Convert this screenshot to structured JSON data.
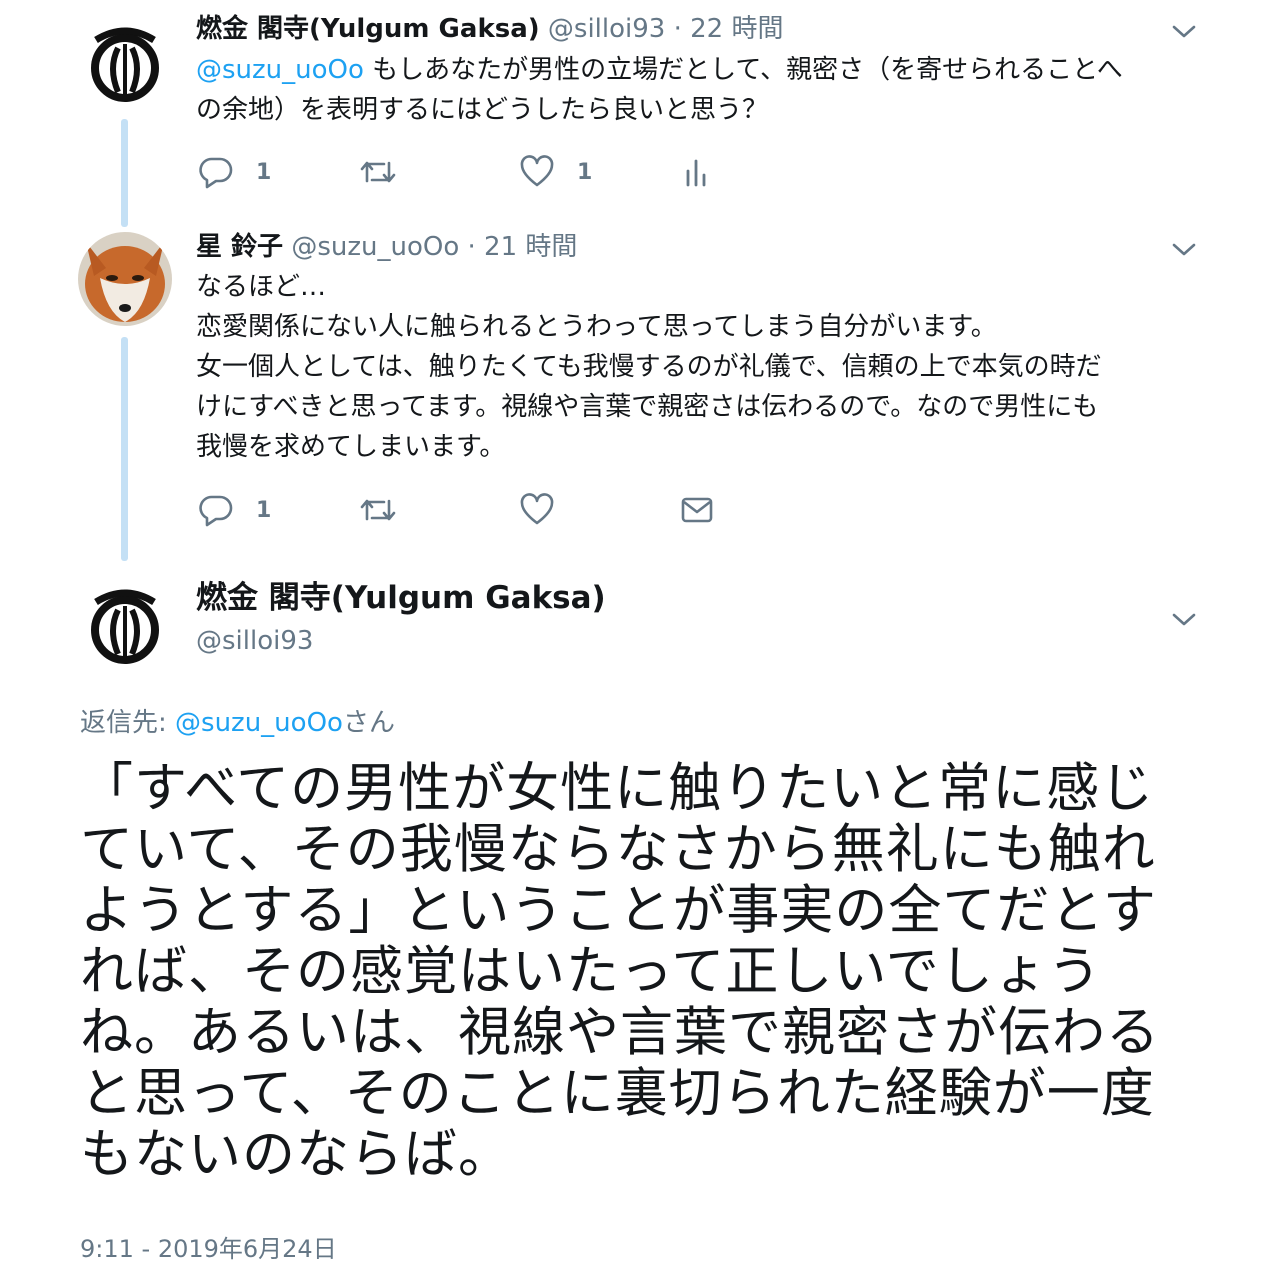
{
  "tweet1": {
    "display_name": "燃金 閣寺(Yulgum Gaksa)",
    "handle": "@silloi93",
    "separator": "·",
    "time": "22 時間",
    "mention": "@suzu_uoOo",
    "text_after_mention": " もしあなたが男性の立場だとして、親密さ（を寄せられることへ",
    "text_line2": "の余地）を表明するにはどうしたら良いと思う？",
    "reply_count": "1",
    "like_count": "1"
  },
  "tweet2": {
    "display_name": "星 鈴子",
    "handle": "@suzu_uoOo",
    "separator": "·",
    "time": "21 時間",
    "lines": [
      "なるほど…",
      "恋愛関係にない人に触られるとうわって思ってしまう自分がいます。",
      "女一個人としては、触りたくても我慢するのが礼儀で、信頼の上で本気の時だ",
      "けにすべきと思ってます。視線や言葉で親密さは伝わるので。なので男性にも",
      "我慢を求めてしまいます。"
    ],
    "reply_count": "1"
  },
  "main": {
    "display_name": "燃金 閣寺(Yulgum Gaksa)",
    "handle": "@silloi93",
    "reply_to_prefix": "返信先: ",
    "reply_to_handle": "@suzu_uoOo",
    "reply_to_suffix": "さん",
    "lines": [
      "「すべての男性が女性に触りたいと常に感じ",
      "ていて、その我慢ならなさから無礼にも触れ",
      "ようとする」ということが事実の全てだとす",
      "れば、その感覚はいたって正しいでしょう",
      "ね。あるいは、視線や言葉で親密さが伝わる",
      "と思って、そのことに裏切られた経験が一度",
      "もないのならば。"
    ],
    "timestamp": "9:11 - 2019年6月24日"
  },
  "colors": {
    "link": "#1da1f2",
    "muted": "#657786",
    "thread_line": "#c4e0f5"
  },
  "icons": [
    "reply-icon",
    "retweet-icon",
    "like-icon",
    "analytics-icon",
    "dm-icon",
    "chevron-down-icon",
    "emblem-avatar",
    "fox-avatar"
  ]
}
